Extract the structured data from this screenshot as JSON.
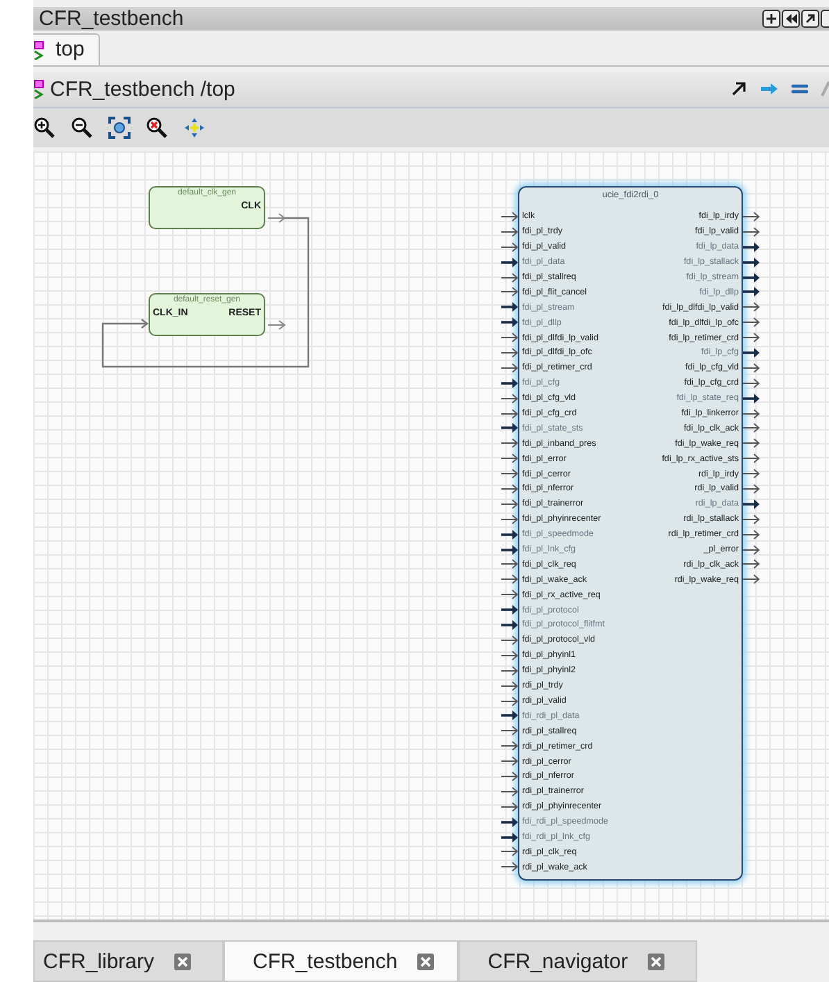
{
  "window": {
    "title": "CFR_testbench"
  },
  "tabs": [
    {
      "label": "top",
      "selected": true
    }
  ],
  "path_bar": {
    "path": "CFR_testbench /top"
  },
  "canvas": {
    "generators": [
      {
        "name": "default_clk_gen",
        "outputs": [
          "CLK"
        ]
      },
      {
        "name": "default_reset_gen",
        "inputs": [
          "CLK_IN"
        ],
        "outputs": [
          "RESET"
        ]
      }
    ],
    "block": {
      "name": "ucie_fdi2rdi_0",
      "inputs": [
        {
          "name": "lclk",
          "kind": "wire"
        },
        {
          "name": "fdi_pl_trdy",
          "kind": "wire"
        },
        {
          "name": "fdi_pl_valid",
          "kind": "wire"
        },
        {
          "name": "fdi_pl_data",
          "kind": "bus"
        },
        {
          "name": "fdi_pl_stallreq",
          "kind": "wire"
        },
        {
          "name": "fdi_pl_flit_cancel",
          "kind": "wire"
        },
        {
          "name": "fdi_pl_stream",
          "kind": "bus"
        },
        {
          "name": "fdi_pl_dllp",
          "kind": "bus"
        },
        {
          "name": "fdi_pl_dlfdi_lp_valid",
          "kind": "wire"
        },
        {
          "name": "fdi_pl_dlfdi_lp_ofc",
          "kind": "wire"
        },
        {
          "name": "fdi_pl_retimer_crd",
          "kind": "wire"
        },
        {
          "name": "fdi_pl_cfg",
          "kind": "bus"
        },
        {
          "name": "fdi_pl_cfg_vld",
          "kind": "wire"
        },
        {
          "name": "fdi_pl_cfg_crd",
          "kind": "wire"
        },
        {
          "name": "fdi_pl_state_sts",
          "kind": "bus"
        },
        {
          "name": "fdi_pl_inband_pres",
          "kind": "wire"
        },
        {
          "name": "fdi_pl_error",
          "kind": "wire"
        },
        {
          "name": "fdi_pl_cerror",
          "kind": "wire"
        },
        {
          "name": "fdi_pl_nferror",
          "kind": "wire"
        },
        {
          "name": "fdi_pl_trainerror",
          "kind": "wire"
        },
        {
          "name": "fdi_pl_phyinrecenter",
          "kind": "wire"
        },
        {
          "name": "fdi_pl_speedmode",
          "kind": "bus"
        },
        {
          "name": "fdi_pl_lnk_cfg",
          "kind": "bus"
        },
        {
          "name": "fdi_pl_clk_req",
          "kind": "wire"
        },
        {
          "name": "fdi_pl_wake_ack",
          "kind": "wire"
        },
        {
          "name": "fdi_pl_rx_active_req",
          "kind": "wire"
        },
        {
          "name": "fdi_pl_protocol",
          "kind": "bus"
        },
        {
          "name": "fdi_pl_protocol_flitfmt",
          "kind": "bus"
        },
        {
          "name": "fdi_pl_protocol_vld",
          "kind": "wire"
        },
        {
          "name": "fdi_pl_phyinl1",
          "kind": "wire"
        },
        {
          "name": "fdi_pl_phyinl2",
          "kind": "wire"
        },
        {
          "name": "rdi_pl_trdy",
          "kind": "wire"
        },
        {
          "name": "rdi_pl_valid",
          "kind": "wire"
        },
        {
          "name": "fdi_rdi_pl_data",
          "kind": "bus"
        },
        {
          "name": "rdi_pl_stallreq",
          "kind": "wire"
        },
        {
          "name": "rdi_pl_retimer_crd",
          "kind": "wire"
        },
        {
          "name": "rdi_pl_cerror",
          "kind": "wire"
        },
        {
          "name": "rdi_pl_nferror",
          "kind": "wire"
        },
        {
          "name": "rdi_pl_trainerror",
          "kind": "wire"
        },
        {
          "name": "rdi_pl_phyinrecenter",
          "kind": "wire"
        },
        {
          "name": "fdi_rdi_pl_speedmode",
          "kind": "bus"
        },
        {
          "name": "fdi_rdi_pl_lnk_cfg",
          "kind": "bus"
        },
        {
          "name": "rdi_pl_clk_req",
          "kind": "wire"
        },
        {
          "name": "rdi_pl_wake_ack",
          "kind": "wire"
        }
      ],
      "outputs": [
        {
          "name": "fdi_lp_irdy",
          "kind": "wire"
        },
        {
          "name": "fdi_lp_valid",
          "kind": "wire"
        },
        {
          "name": "fdi_lp_data",
          "kind": "bus"
        },
        {
          "name": "fdi_lp_stallack",
          "kind": "bus"
        },
        {
          "name": "fdi_lp_stream",
          "kind": "bus"
        },
        {
          "name": "fdi_lp_dllp",
          "kind": "bus"
        },
        {
          "name": "fdi_lp_dlfdi_lp_valid",
          "kind": "wire"
        },
        {
          "name": "fdi_lp_dlfdi_lp_ofc",
          "kind": "wire"
        },
        {
          "name": "fdi_lp_retimer_crd",
          "kind": "wire"
        },
        {
          "name": "fdi_lp_cfg",
          "kind": "bus"
        },
        {
          "name": "fdi_lp_cfg_vld",
          "kind": "wire"
        },
        {
          "name": "fdi_lp_cfg_crd",
          "kind": "wire"
        },
        {
          "name": "fdi_lp_state_req",
          "kind": "bus"
        },
        {
          "name": "fdi_lp_linkerror",
          "kind": "wire"
        },
        {
          "name": "fdi_lp_clk_ack",
          "kind": "wire"
        },
        {
          "name": "fdi_lp_wake_req",
          "kind": "wire"
        },
        {
          "name": "fdi_lp_rx_active_sts",
          "kind": "wire"
        },
        {
          "name": "rdi_lp_irdy",
          "kind": "wire"
        },
        {
          "name": "rdi_lp_valid",
          "kind": "wire"
        },
        {
          "name": "rdi_lp_data",
          "kind": "bus"
        },
        {
          "name": "rdi_lp_stallack",
          "kind": "wire"
        },
        {
          "name": "rdi_lp_retimer_crd",
          "kind": "wire"
        },
        {
          "name": "_pl_error",
          "kind": "wire"
        },
        {
          "name": "rdi_lp_clk_ack",
          "kind": "wire"
        },
        {
          "name": "rdi_lp_wake_req",
          "kind": "wire"
        }
      ]
    }
  },
  "bottom_tabs": [
    {
      "label": "CFR_library",
      "selected": false
    },
    {
      "label": "CFR_testbench",
      "selected": true
    },
    {
      "label": "CFR_navigator",
      "selected": false
    }
  ]
}
